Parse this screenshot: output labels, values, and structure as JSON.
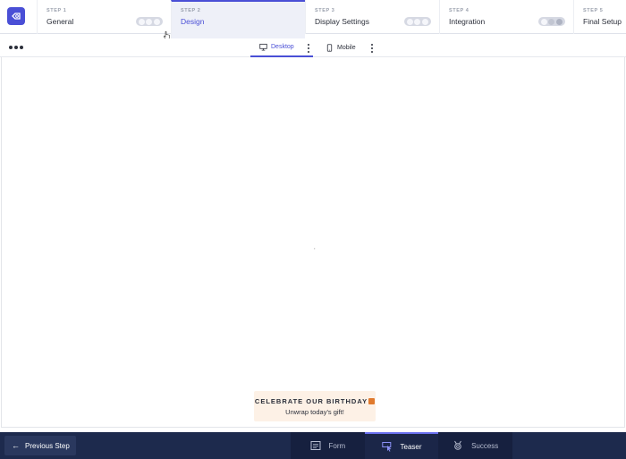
{
  "colors": {
    "accent": "#4a4fd6",
    "bottom_bg": "#1d2a4d",
    "teaser_bg": "#fdf1e6"
  },
  "logo": {
    "icon": "logo-icon"
  },
  "steps": [
    {
      "small": "STEP 1",
      "label": "General",
      "active": false,
      "toggle": "three-dot"
    },
    {
      "small": "STEP 2",
      "label": "Design",
      "active": true
    },
    {
      "small": "STEP 3",
      "label": "Display Settings",
      "active": false,
      "toggle": "three-dot"
    },
    {
      "small": "STEP 4",
      "label": "Integration",
      "active": false,
      "toggle": "three-dot-on"
    },
    {
      "small": "STEP 5",
      "label": "Final Setup",
      "active": false
    }
  ],
  "device_bar": {
    "more_icon": "more-horizontal-icon",
    "tabs": [
      {
        "label": "Desktop",
        "icon": "desktop-icon",
        "active": true
      },
      {
        "label": "Mobile",
        "icon": "mobile-icon",
        "active": false
      }
    ]
  },
  "canvas": {
    "center_mark": ",",
    "teaser": {
      "title": "CELEBRATE OUR BIRTHDAY",
      "subtitle": "Unwrap today's gift!",
      "icon": "gift-icon"
    }
  },
  "bottom": {
    "prev_label": "Previous Step",
    "prev_icon": "arrow-left-icon",
    "modes": [
      {
        "label": "Form",
        "icon": "form-icon",
        "active": false
      },
      {
        "label": "Teaser",
        "icon": "teaser-icon",
        "active": true
      },
      {
        "label": "Success",
        "icon": "badge-icon",
        "active": false
      }
    ]
  }
}
